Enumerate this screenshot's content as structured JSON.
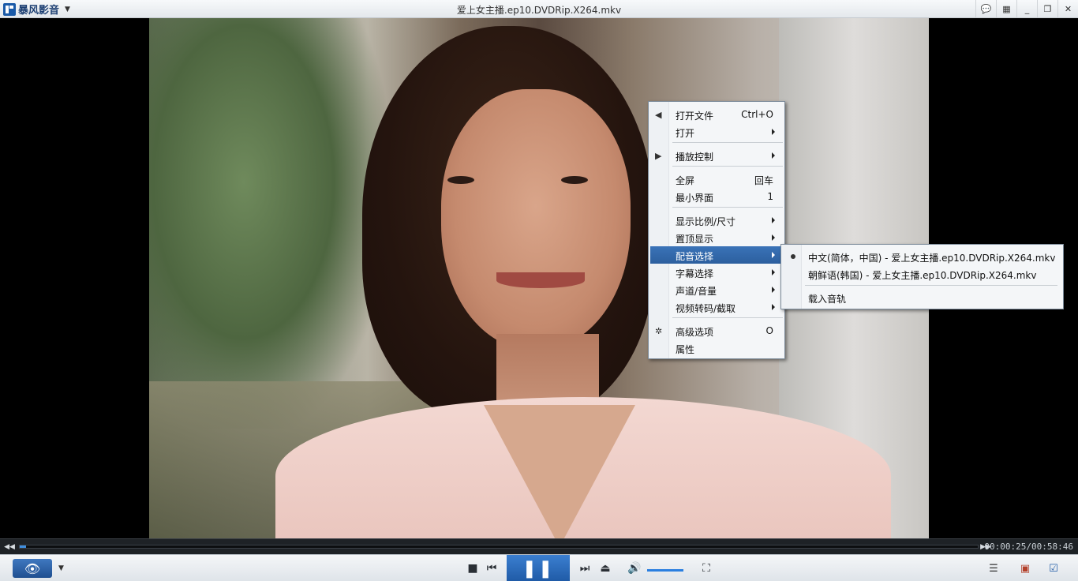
{
  "app": {
    "logo_text": "暴风影音",
    "window_title": "爱上女主播.ep10.DVDRip.X264.mkv"
  },
  "context_menu": {
    "items": [
      {
        "label": "打开文件",
        "shortcut": "Ctrl+O",
        "icon": "open-file-icon"
      },
      {
        "label": "打开",
        "submenu": true
      },
      {
        "label": "播放控制",
        "submenu": true,
        "icon": "play-triangle-icon"
      },
      {
        "label": "全屏",
        "shortcut": "回车"
      },
      {
        "label": "最小界面",
        "shortcut": "1"
      },
      {
        "label": "显示比例/尺寸",
        "submenu": true
      },
      {
        "label": "置顶显示",
        "submenu": true
      },
      {
        "label": "配音选择",
        "submenu": true,
        "highlighted": true
      },
      {
        "label": "字幕选择",
        "submenu": true
      },
      {
        "label": "声道/音量",
        "submenu": true
      },
      {
        "label": "视频转码/截取",
        "submenu": true
      },
      {
        "label": "高级选项",
        "shortcut": "O",
        "icon": "gear-icon"
      },
      {
        "label": "属性"
      }
    ]
  },
  "submenu": {
    "items": [
      {
        "label": "中文(简体，中国) - 爱上女主播.ep10.DVDRip.X264.mkv",
        "selected": true
      },
      {
        "label": "朝鲜语(韩国) - 爱上女主播.ep10.DVDRip.X264.mkv"
      },
      {
        "label": "载入音轨"
      }
    ]
  },
  "playback": {
    "time": "00:00:25/00:58:46",
    "progress_fraction": 0.007,
    "volume_fraction": 1.0
  },
  "colors": {
    "accent": "#2c5f9e",
    "progress": "#3f8fe0"
  }
}
